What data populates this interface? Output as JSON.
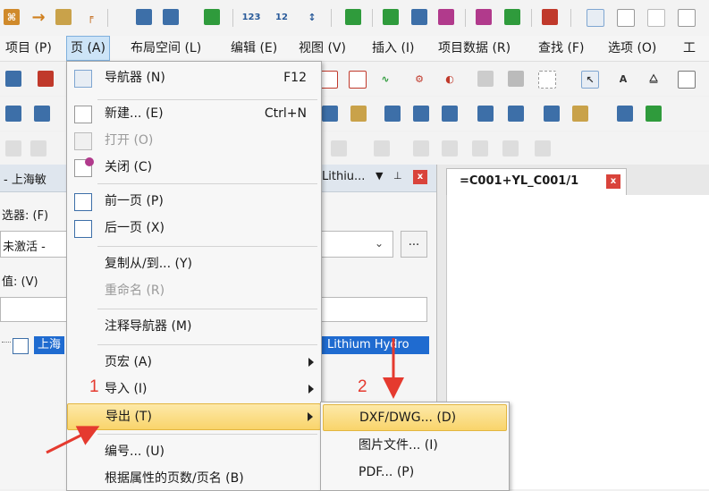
{
  "menubar": {
    "items": [
      "项目 (P)",
      "页 (A)",
      "布局空间 (L)",
      "编辑 (E)",
      "视图 (V)",
      "插入 (I)",
      "项目数据 (R)",
      "查找 (F)",
      "选项 (O)",
      "工具"
    ]
  },
  "left_panel": {
    "title": "- 上海敏",
    "title_right": "Lithiu...",
    "filter_label": "选器: (F)",
    "filter_value": "未激活 -",
    "value_label": "值: (V)",
    "browse_button": "...",
    "tree_item_left": "上海",
    "tree_item_right": "Lithium  Hydro"
  },
  "document_tab": {
    "title": "=C001+YL_C001/1",
    "close": "x"
  },
  "dropdown": {
    "items": [
      {
        "label": "导航器 (N)",
        "shortcut": "F12"
      },
      {
        "label": "新建... (E)",
        "shortcut": "Ctrl+N"
      },
      {
        "label": "打开 (O)",
        "shortcut": ""
      },
      {
        "label": "关闭 (C)",
        "shortcut": ""
      },
      {
        "label": "前一页 (P)",
        "shortcut": ""
      },
      {
        "label": "后一页 (X)",
        "shortcut": ""
      },
      {
        "label": "复制从/到... (Y)",
        "shortcut": ""
      },
      {
        "label": "重命名 (R)",
        "shortcut": ""
      },
      {
        "label": "注释导航器 (M)",
        "shortcut": ""
      },
      {
        "label": "页宏 (A)",
        "shortcut": ""
      },
      {
        "label": "导入 (I)",
        "shortcut": ""
      },
      {
        "label": "导出 (T)",
        "shortcut": ""
      },
      {
        "label": "编号... (U)",
        "shortcut": ""
      },
      {
        "label": "根据属性的页数/页名 (B)",
        "shortcut": ""
      }
    ]
  },
  "submenu": {
    "items": [
      "DXF/DWG... (D)",
      "图片文件... (I)",
      "PDF... (P)"
    ]
  },
  "annotations": {
    "marker_1": "1",
    "marker_2": "2",
    "color": "#e53a2f"
  }
}
